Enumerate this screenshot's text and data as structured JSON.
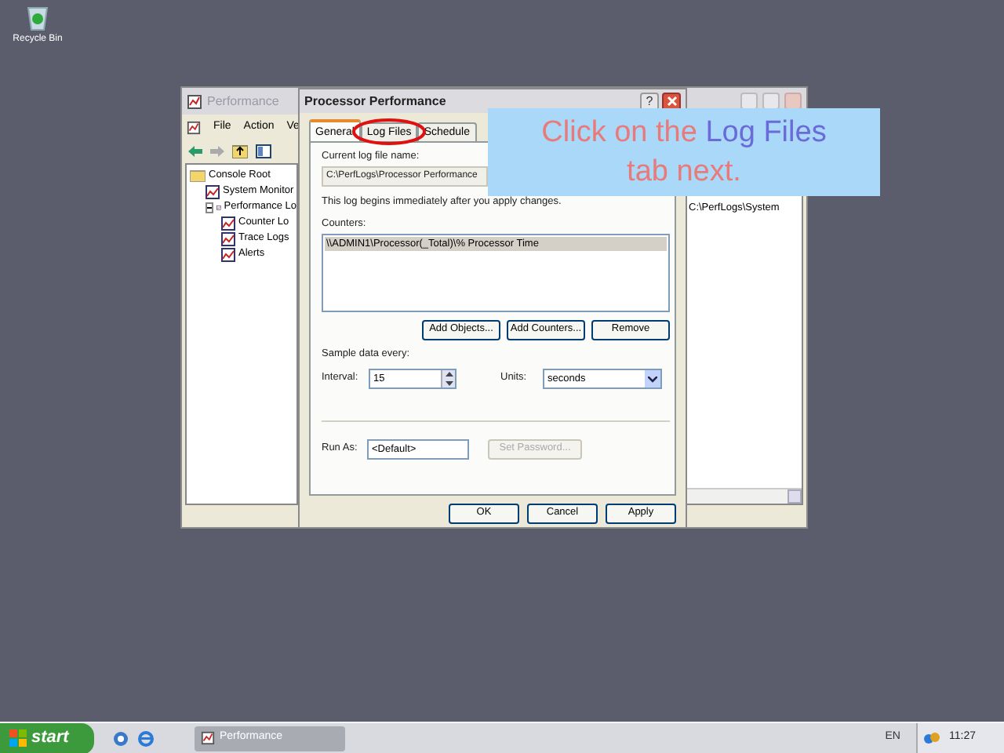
{
  "desktop": {
    "icons": [
      {
        "label": "Recycle Bin"
      }
    ]
  },
  "background_window": {
    "title": "Performance",
    "menu": [
      "File",
      "Action",
      "Ve"
    ],
    "tree": [
      {
        "label": "Console Root",
        "children": [
          {
            "label": "System Monitor"
          },
          {
            "label": "Performance Lo",
            "expanded": true,
            "children": [
              {
                "label": "Counter Lo"
              },
              {
                "label": "Trace Logs"
              },
              {
                "label": "Alerts"
              }
            ]
          }
        ]
      }
    ],
    "right_pane_text": "C:\\PerfLogs\\System"
  },
  "dialog": {
    "title": "Processor Performance",
    "help": "?",
    "tabs": [
      {
        "label": "General",
        "selected": true
      },
      {
        "label": "Log Files",
        "selected": false
      },
      {
        "label": "Schedule",
        "selected": false
      }
    ],
    "current_log_label": "Current log file name:",
    "current_log_value": "C:\\PerfLogs\\Processor Performance",
    "note": "This log begins immediately after you apply changes.",
    "counters_label": "Counters:",
    "counters": [
      {
        "text": "\\\\ADMIN1\\Processor(_Total)\\% Processor Time",
        "selected": true
      }
    ],
    "counter_buttons": [
      "Add Objects...",
      "Add Counters...",
      "Remove"
    ],
    "sample_label": "Sample data every:",
    "interval_label": "Interval:",
    "interval_value": "15",
    "units_label": "Units:",
    "units_value": "seconds",
    "run_as_label": "Run As:",
    "run_as_value": "<Default>",
    "set_password": {
      "label": "Set Password...",
      "disabled": true
    },
    "footer_buttons": [
      "OK",
      "Cancel",
      "Apply"
    ]
  },
  "callout": {
    "parts": [
      {
        "text": "Click on the ",
        "highlight": false
      },
      {
        "text": "Log Files",
        "highlight": true
      },
      {
        "text": " tab next.",
        "highlight": false
      }
    ]
  },
  "taskbar": {
    "start": "start",
    "tasks": [
      {
        "label": "Performance"
      }
    ],
    "language": "EN",
    "clock": "11:27"
  }
}
